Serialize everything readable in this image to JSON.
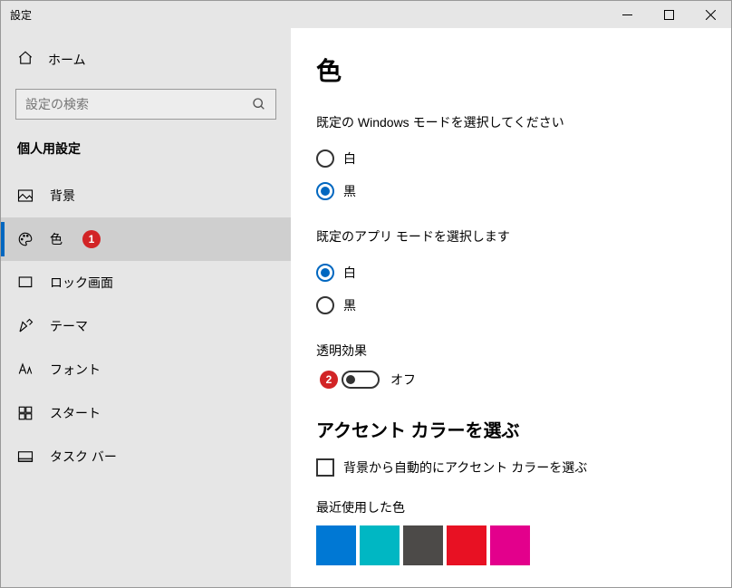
{
  "window": {
    "title": "設定"
  },
  "sidebar": {
    "home": "ホーム",
    "search_placeholder": "設定の検索",
    "section": "個人用設定",
    "items": [
      {
        "label": "背景"
      },
      {
        "label": "色",
        "badge": "1"
      },
      {
        "label": "ロック画面"
      },
      {
        "label": "テーマ"
      },
      {
        "label": "フォント"
      },
      {
        "label": "スタート"
      },
      {
        "label": "タスク バー"
      }
    ]
  },
  "content": {
    "title": "色",
    "windows_mode_label": "既定の Windows モードを選択してください",
    "windows_mode": {
      "light": "白",
      "dark": "黒"
    },
    "app_mode_label": "既定のアプリ モードを選択します",
    "app_mode": {
      "light": "白",
      "dark": "黒"
    },
    "transparency_label": "透明効果",
    "transparency_badge": "2",
    "transparency_state": "オフ",
    "accent_title": "アクセント カラーを選ぶ",
    "accent_auto": "背景から自動的にアクセント カラーを選ぶ",
    "recent_label": "最近使用した色",
    "recent_colors": [
      "#0078d4",
      "#00b7c3",
      "#4c4a48",
      "#e81123",
      "#e3008c"
    ]
  }
}
